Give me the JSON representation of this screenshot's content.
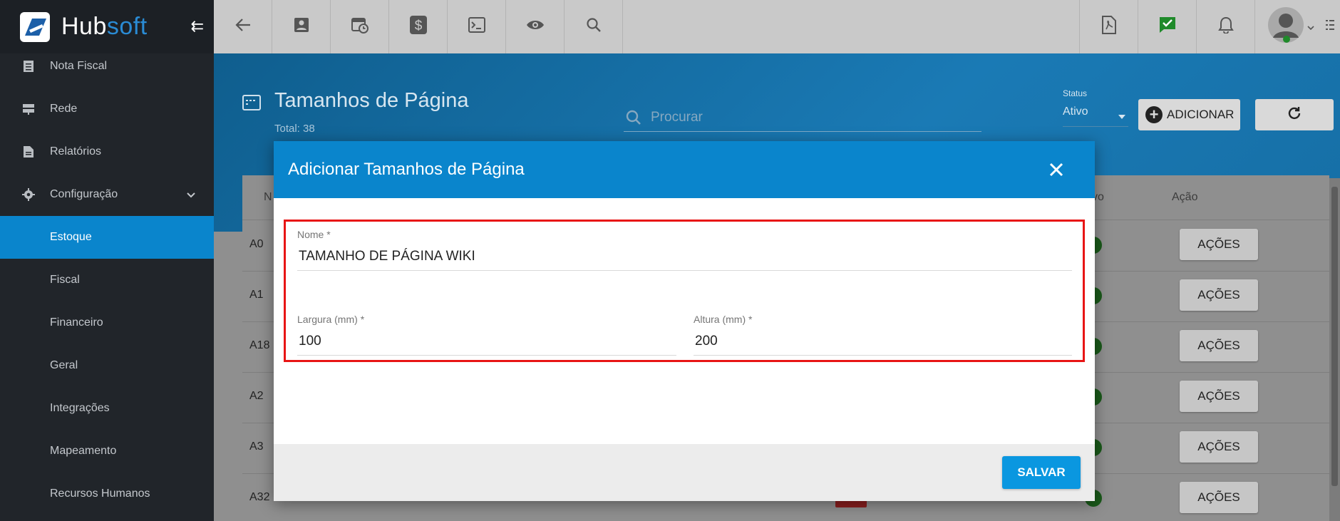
{
  "app": {
    "logo_main": "Hub",
    "logo_accent": "soft"
  },
  "sidebar": {
    "items": [
      {
        "label": "Nota Fiscal",
        "icon": "document-icon"
      },
      {
        "label": "Rede",
        "icon": "server-icon"
      },
      {
        "label": "Relatórios",
        "icon": "report-icon"
      },
      {
        "label": "Configuração",
        "icon": "gear-icon"
      },
      {
        "label": "Estoque"
      },
      {
        "label": "Fiscal"
      },
      {
        "label": "Financeiro"
      },
      {
        "label": "Geral"
      },
      {
        "label": "Integrações"
      },
      {
        "label": "Mapeamento"
      },
      {
        "label": "Recursos Humanos"
      }
    ],
    "active": "Estoque"
  },
  "page": {
    "title": "Tamanhos de Página",
    "total": "Total: 38",
    "search_placeholder": "Procurar",
    "status_label": "Status",
    "status_value": "Ativo",
    "add_label": "ADICIONAR"
  },
  "table": {
    "col_partial_left": "N",
    "col_partial_right": "vo",
    "col_action": "Ação",
    "rows": [
      "A0",
      "A1",
      "A18",
      "A2",
      "A3",
      "A32"
    ],
    "action_label": "AÇÕES"
  },
  "modal": {
    "title": "Adicionar Tamanhos de Página",
    "name_label": "Nome",
    "name_value": "TAMANHO DE PÁGINA WIKI",
    "width_label": "Largura (mm)",
    "width_value": "100",
    "height_label": "Altura (mm)",
    "height_value": "200",
    "required_mark": "*",
    "save_label": "SALVAR"
  },
  "colors": {
    "accent": "#0a85cc",
    "highlight": "#e81515",
    "save": "#0a97e0"
  }
}
